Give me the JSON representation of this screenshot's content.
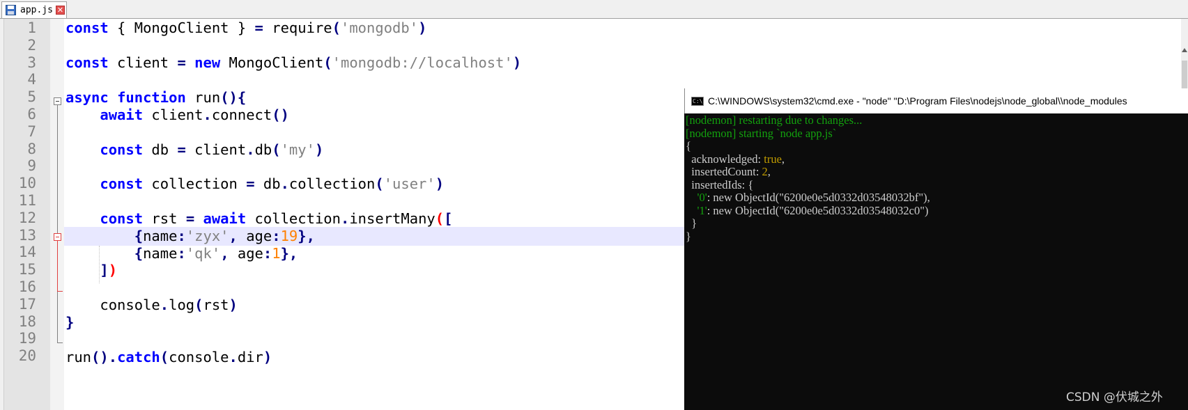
{
  "tab": {
    "name": "app.js",
    "close_glyph": "✕",
    "save_icon": "floppy-disk-icon"
  },
  "editor": {
    "line_numbers": [
      "1",
      "2",
      "3",
      "4",
      "5",
      "6",
      "7",
      "8",
      "9",
      "10",
      "11",
      "12",
      "13",
      "14",
      "15",
      "16",
      "17",
      "18",
      "19",
      "20"
    ],
    "current_line": "12",
    "lines": {
      "l1": [
        [
          "kw",
          "const"
        ],
        [
          "plain",
          " { MongoClient } "
        ],
        [
          "op",
          "="
        ],
        [
          "plain",
          " require"
        ],
        [
          "op",
          "("
        ],
        [
          "str",
          "'mongodb'"
        ],
        [
          "op",
          ")"
        ]
      ],
      "l3": [
        [
          "kw",
          "const"
        ],
        [
          "plain",
          " client "
        ],
        [
          "op",
          "="
        ],
        [
          "plain",
          " "
        ],
        [
          "kw",
          "new"
        ],
        [
          "plain",
          " MongoClient"
        ],
        [
          "op",
          "("
        ],
        [
          "str",
          "'mongodb://localhost'"
        ],
        [
          "op",
          ")"
        ]
      ],
      "l5": [
        [
          "kw",
          "async"
        ],
        [
          "plain",
          " "
        ],
        [
          "kw",
          "function"
        ],
        [
          "plain",
          " run"
        ],
        [
          "op",
          "(){"
        ]
      ],
      "l6": [
        [
          "plain",
          "    "
        ],
        [
          "kw",
          "await"
        ],
        [
          "plain",
          " client"
        ],
        [
          "op",
          "."
        ],
        [
          "plain",
          "connect"
        ],
        [
          "op",
          "()"
        ]
      ],
      "l8": [
        [
          "plain",
          "    "
        ],
        [
          "kw",
          "const"
        ],
        [
          "plain",
          " db "
        ],
        [
          "op",
          "="
        ],
        [
          "plain",
          " client"
        ],
        [
          "op",
          "."
        ],
        [
          "plain",
          "db"
        ],
        [
          "op",
          "("
        ],
        [
          "str",
          "'my'"
        ],
        [
          "op",
          ")"
        ]
      ],
      "l10": [
        [
          "plain",
          "    "
        ],
        [
          "kw",
          "const"
        ],
        [
          "plain",
          " collection "
        ],
        [
          "op",
          "="
        ],
        [
          "plain",
          " db"
        ],
        [
          "op",
          "."
        ],
        [
          "plain",
          "collection"
        ],
        [
          "op",
          "("
        ],
        [
          "str",
          "'user'"
        ],
        [
          "op",
          ")"
        ]
      ],
      "l12": [
        [
          "plain",
          "    "
        ],
        [
          "kw",
          "const"
        ],
        [
          "plain",
          " rst "
        ],
        [
          "op",
          "="
        ],
        [
          "plain",
          " "
        ],
        [
          "kw",
          "await"
        ],
        [
          "plain",
          " collection"
        ],
        [
          "op",
          "."
        ],
        [
          "plain",
          "insertMany"
        ],
        [
          "brace",
          "("
        ],
        [
          "op",
          "["
        ]
      ],
      "l13": [
        [
          "plain",
          "        "
        ],
        [
          "op",
          "{"
        ],
        [
          "plain",
          "name"
        ],
        [
          "op",
          ":"
        ],
        [
          "str",
          "'zyx'"
        ],
        [
          "op",
          ","
        ],
        [
          "plain",
          " age"
        ],
        [
          "op",
          ":"
        ],
        [
          "num",
          "19"
        ],
        [
          "op",
          "},"
        ]
      ],
      "l14": [
        [
          "plain",
          "        "
        ],
        [
          "op",
          "{"
        ],
        [
          "plain",
          "name"
        ],
        [
          "op",
          ":"
        ],
        [
          "str",
          "'qk'"
        ],
        [
          "op",
          ","
        ],
        [
          "plain",
          " age"
        ],
        [
          "op",
          ":"
        ],
        [
          "num",
          "1"
        ],
        [
          "op",
          "},"
        ]
      ],
      "l15": [
        [
          "plain",
          "    "
        ],
        [
          "op",
          "]"
        ],
        [
          "brace",
          ")"
        ]
      ],
      "l17": [
        [
          "plain",
          "    console"
        ],
        [
          "op",
          "."
        ],
        [
          "plain",
          "log"
        ],
        [
          "op",
          "("
        ],
        [
          "plain",
          "rst"
        ],
        [
          "op",
          ")"
        ]
      ],
      "l18": [
        [
          "op",
          "}"
        ]
      ],
      "l20": [
        [
          "plain",
          "run"
        ],
        [
          "op",
          "()."
        ],
        [
          "kw",
          "catch"
        ],
        [
          "op",
          "("
        ],
        [
          "plain",
          "console"
        ],
        [
          "op",
          "."
        ],
        [
          "plain",
          "dir"
        ],
        [
          "op",
          ")"
        ]
      ]
    }
  },
  "cmd": {
    "title": "C:\\WINDOWS\\system32\\cmd.exe - \"node\"  \"D:\\Program Files\\nodejs\\node_global\\\\node_modules",
    "icon_label": "C:\\",
    "lines": [
      [
        [
          "green",
          "[nodemon] restarting due to changes..."
        ]
      ],
      [
        [
          "green",
          "[nodemon] starting `node app.js`"
        ]
      ],
      [
        [
          "white",
          "{"
        ]
      ],
      [
        [
          "white",
          "  acknowledged: "
        ],
        [
          "yellow",
          "true"
        ],
        [
          "white",
          ","
        ]
      ],
      [
        [
          "white",
          "  insertedCount: "
        ],
        [
          "yellow",
          "2"
        ],
        [
          "white",
          ","
        ]
      ],
      [
        [
          "white",
          "  insertedIds: {"
        ]
      ],
      [
        [
          "white",
          "    "
        ],
        [
          "green",
          "'0'"
        ],
        [
          "white",
          ": new ObjectId(\"6200e0e5d0332d03548032bf\"),"
        ]
      ],
      [
        [
          "white",
          "    "
        ],
        [
          "green",
          "'1'"
        ],
        [
          "white",
          ": new ObjectId(\"6200e0e5d0332d03548032c0\")"
        ]
      ],
      [
        [
          "white",
          "  }"
        ]
      ],
      [
        [
          "white",
          "}"
        ]
      ]
    ]
  },
  "watermark": "CSDN @伏城之外",
  "colors": {
    "keyword": "#0000ff",
    "operator": "#000080",
    "string": "#808080",
    "number": "#ff8000",
    "console_green": "#13a10e",
    "console_yellow": "#c19c00",
    "console_bg": "#0c0c0c"
  }
}
